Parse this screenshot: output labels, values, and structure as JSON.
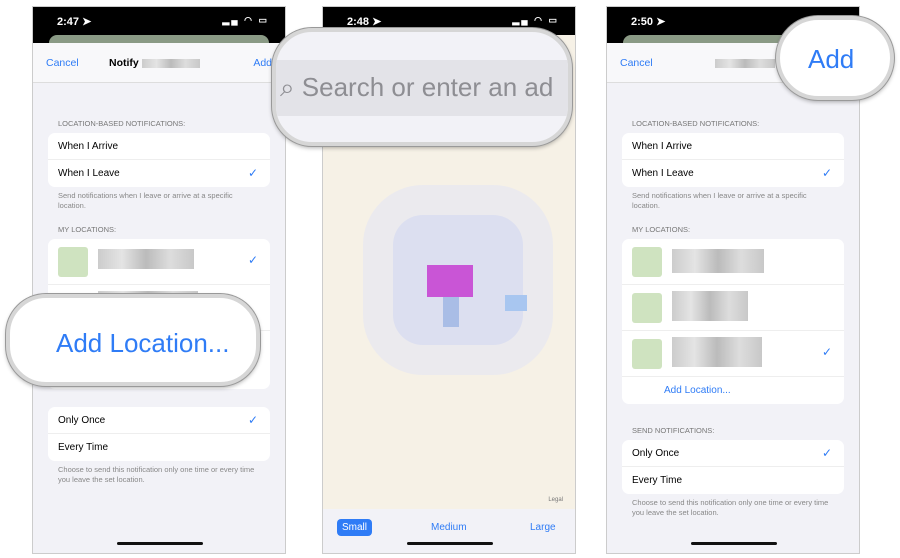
{
  "left": {
    "time": "2:47",
    "nav": {
      "cancel": "Cancel",
      "title": "Notify",
      "add": "Add"
    },
    "section_location": "LOCATION-BASED NOTIFICATIONS:",
    "arrive": "When I Arrive",
    "leave": "When I Leave",
    "location_footer": "Send notifications when I leave or arrive at a specific location.",
    "section_my": "MY LOCATIONS:",
    "add_location_magnified": "Add Location...",
    "once": "Only Once",
    "every": "Every Time",
    "send_footer": "Choose to send this notification only one time or every time you leave the set location."
  },
  "middle": {
    "time": "2:48",
    "search_placeholder": "Search or enter an ad",
    "legal": "Legal",
    "sizes": [
      "Small",
      "Medium",
      "Large"
    ],
    "selected_size": "Small"
  },
  "right": {
    "time": "2:50",
    "nav": {
      "cancel": "Cancel",
      "add_magnified": "Add"
    },
    "section_location": "LOCATION-BASED NOTIFICATIONS:",
    "arrive": "When I Arrive",
    "leave": "When I Leave",
    "location_footer": "Send notifications when I leave or arrive at a specific location.",
    "section_my": "MY LOCATIONS:",
    "add_location": "Add Location...",
    "section_send": "SEND NOTIFICATIONS:",
    "once": "Only Once",
    "every": "Every Time",
    "send_footer": "Choose to send this notification only one time or every time you leave the set location."
  },
  "colors": {
    "accent": "#2f7cf6",
    "background": "#f2f2f7"
  }
}
